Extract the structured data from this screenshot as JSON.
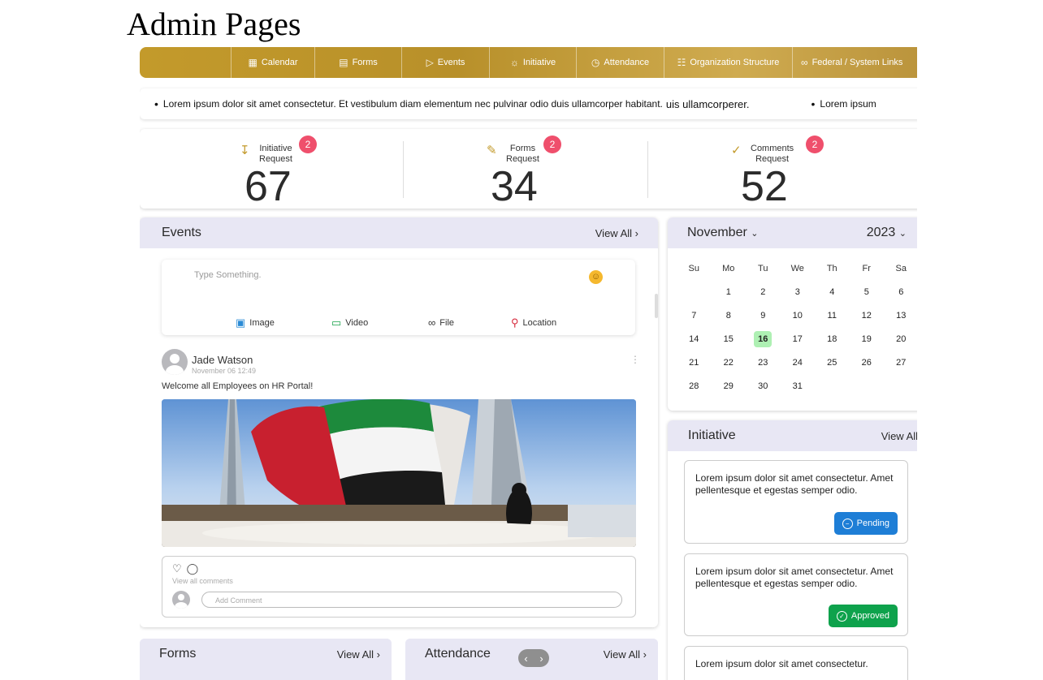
{
  "page_title": "Admin Pages",
  "nav": [
    {
      "label": "Calendar",
      "icon": "calendar-icon"
    },
    {
      "label": "Forms",
      "icon": "document-icon"
    },
    {
      "label": "Events",
      "icon": "megaphone-icon"
    },
    {
      "label": "Initiative",
      "icon": "lightbulb-icon"
    },
    {
      "label": "Attendance",
      "icon": "clock-icon"
    },
    {
      "label": "Organization Structure",
      "icon": "org-chart-icon"
    },
    {
      "label": "Federal / System Links",
      "icon": "link-icon"
    }
  ],
  "ticker": {
    "text1": "Lorem ipsum dolor sit amet consectetur. Et vestibulum diam elementum nec pulvinar odio duis ullamcorper habitant.",
    "text1_tail": "uis ullamcorperer.",
    "text2": "Lorem ipsum"
  },
  "stats": [
    {
      "line1": "Initiative",
      "line2": "Request",
      "value": "67",
      "badge": "2",
      "icon": "download-box-icon"
    },
    {
      "line1": "Forms",
      "line2": "Request",
      "value": "34",
      "badge": "2",
      "icon": "form-edit-icon"
    },
    {
      "line1": "Comments",
      "line2": "Request",
      "value": "52",
      "badge": "2",
      "icon": "comment-check-icon"
    }
  ],
  "events": {
    "title": "Events",
    "view_all": "View All",
    "composer": {
      "placeholder": "Type Something.",
      "actions": [
        "Image",
        "Video",
        "File",
        "Location"
      ]
    },
    "post": {
      "author": "Jade Watson",
      "time": "November 06 12:49",
      "text": "Welcome all Employees on HR Portal!",
      "view_comments": "View all comments",
      "add_comment": "Add Comment"
    }
  },
  "forms": {
    "title": "Forms",
    "view_all": "View All"
  },
  "attendance": {
    "title": "Attendance",
    "view_all": "View All"
  },
  "calendar": {
    "month": "November",
    "year": "2023",
    "days_of_week": [
      "Su",
      "Mo",
      "Tu",
      "We",
      "Th",
      "Fr",
      "Sa"
    ],
    "weeks": [
      [
        "",
        "1",
        "2",
        "3",
        "4",
        "5",
        "6"
      ],
      [
        "7",
        "8",
        "9",
        "10",
        "11",
        "12",
        "13"
      ],
      [
        "14",
        "15",
        "16",
        "17",
        "18",
        "19",
        "20"
      ],
      [
        "21",
        "22",
        "23",
        "24",
        "25",
        "26",
        "27"
      ],
      [
        "28",
        "29",
        "30",
        "31",
        "",
        "",
        ""
      ]
    ],
    "selected_day": "16"
  },
  "initiative": {
    "title": "Initiative",
    "view_all": "View All",
    "cards": [
      {
        "text": "Lorem ipsum dolor sit amet consectetur. Amet pellentesque et egestas semper odio.",
        "status": "Pending",
        "status_color": "#1e7ed6"
      },
      {
        "text": "Lorem ipsum dolor sit amet consectetur. Amet pellentesque et egestas semper odio.",
        "status": "Approved",
        "status_color": "#0ea24c"
      },
      {
        "text": "Lorem ipsum dolor sit amet consectetur."
      }
    ]
  },
  "colors": {
    "accent_gold": "#c39a2b",
    "badge": "#ef4f6c",
    "panel_header": "#e8e7f4",
    "today_highlight": "#aef0b3"
  }
}
